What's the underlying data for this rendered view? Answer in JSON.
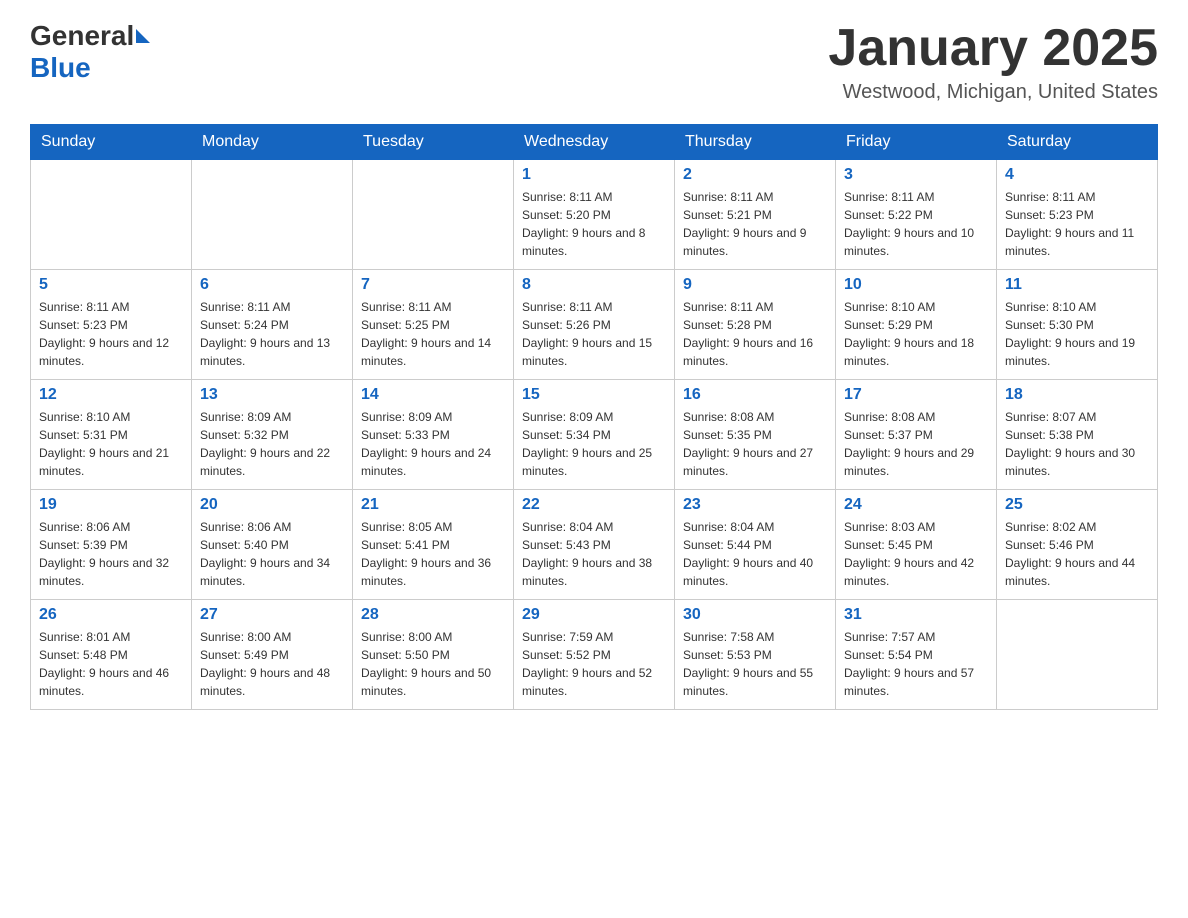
{
  "header": {
    "logo": {
      "general": "General",
      "blue": "Blue"
    },
    "title": "January 2025",
    "location": "Westwood, Michigan, United States"
  },
  "weekdays": [
    "Sunday",
    "Monday",
    "Tuesday",
    "Wednesday",
    "Thursday",
    "Friday",
    "Saturday"
  ],
  "weeks": [
    [
      {
        "day": "",
        "sunrise": "",
        "sunset": "",
        "daylight": ""
      },
      {
        "day": "",
        "sunrise": "",
        "sunset": "",
        "daylight": ""
      },
      {
        "day": "",
        "sunrise": "",
        "sunset": "",
        "daylight": ""
      },
      {
        "day": "1",
        "sunrise": "Sunrise: 8:11 AM",
        "sunset": "Sunset: 5:20 PM",
        "daylight": "Daylight: 9 hours and 8 minutes."
      },
      {
        "day": "2",
        "sunrise": "Sunrise: 8:11 AM",
        "sunset": "Sunset: 5:21 PM",
        "daylight": "Daylight: 9 hours and 9 minutes."
      },
      {
        "day": "3",
        "sunrise": "Sunrise: 8:11 AM",
        "sunset": "Sunset: 5:22 PM",
        "daylight": "Daylight: 9 hours and 10 minutes."
      },
      {
        "day": "4",
        "sunrise": "Sunrise: 8:11 AM",
        "sunset": "Sunset: 5:23 PM",
        "daylight": "Daylight: 9 hours and 11 minutes."
      }
    ],
    [
      {
        "day": "5",
        "sunrise": "Sunrise: 8:11 AM",
        "sunset": "Sunset: 5:23 PM",
        "daylight": "Daylight: 9 hours and 12 minutes."
      },
      {
        "day": "6",
        "sunrise": "Sunrise: 8:11 AM",
        "sunset": "Sunset: 5:24 PM",
        "daylight": "Daylight: 9 hours and 13 minutes."
      },
      {
        "day": "7",
        "sunrise": "Sunrise: 8:11 AM",
        "sunset": "Sunset: 5:25 PM",
        "daylight": "Daylight: 9 hours and 14 minutes."
      },
      {
        "day": "8",
        "sunrise": "Sunrise: 8:11 AM",
        "sunset": "Sunset: 5:26 PM",
        "daylight": "Daylight: 9 hours and 15 minutes."
      },
      {
        "day": "9",
        "sunrise": "Sunrise: 8:11 AM",
        "sunset": "Sunset: 5:28 PM",
        "daylight": "Daylight: 9 hours and 16 minutes."
      },
      {
        "day": "10",
        "sunrise": "Sunrise: 8:10 AM",
        "sunset": "Sunset: 5:29 PM",
        "daylight": "Daylight: 9 hours and 18 minutes."
      },
      {
        "day": "11",
        "sunrise": "Sunrise: 8:10 AM",
        "sunset": "Sunset: 5:30 PM",
        "daylight": "Daylight: 9 hours and 19 minutes."
      }
    ],
    [
      {
        "day": "12",
        "sunrise": "Sunrise: 8:10 AM",
        "sunset": "Sunset: 5:31 PM",
        "daylight": "Daylight: 9 hours and 21 minutes."
      },
      {
        "day": "13",
        "sunrise": "Sunrise: 8:09 AM",
        "sunset": "Sunset: 5:32 PM",
        "daylight": "Daylight: 9 hours and 22 minutes."
      },
      {
        "day": "14",
        "sunrise": "Sunrise: 8:09 AM",
        "sunset": "Sunset: 5:33 PM",
        "daylight": "Daylight: 9 hours and 24 minutes."
      },
      {
        "day": "15",
        "sunrise": "Sunrise: 8:09 AM",
        "sunset": "Sunset: 5:34 PM",
        "daylight": "Daylight: 9 hours and 25 minutes."
      },
      {
        "day": "16",
        "sunrise": "Sunrise: 8:08 AM",
        "sunset": "Sunset: 5:35 PM",
        "daylight": "Daylight: 9 hours and 27 minutes."
      },
      {
        "day": "17",
        "sunrise": "Sunrise: 8:08 AM",
        "sunset": "Sunset: 5:37 PM",
        "daylight": "Daylight: 9 hours and 29 minutes."
      },
      {
        "day": "18",
        "sunrise": "Sunrise: 8:07 AM",
        "sunset": "Sunset: 5:38 PM",
        "daylight": "Daylight: 9 hours and 30 minutes."
      }
    ],
    [
      {
        "day": "19",
        "sunrise": "Sunrise: 8:06 AM",
        "sunset": "Sunset: 5:39 PM",
        "daylight": "Daylight: 9 hours and 32 minutes."
      },
      {
        "day": "20",
        "sunrise": "Sunrise: 8:06 AM",
        "sunset": "Sunset: 5:40 PM",
        "daylight": "Daylight: 9 hours and 34 minutes."
      },
      {
        "day": "21",
        "sunrise": "Sunrise: 8:05 AM",
        "sunset": "Sunset: 5:41 PM",
        "daylight": "Daylight: 9 hours and 36 minutes."
      },
      {
        "day": "22",
        "sunrise": "Sunrise: 8:04 AM",
        "sunset": "Sunset: 5:43 PM",
        "daylight": "Daylight: 9 hours and 38 minutes."
      },
      {
        "day": "23",
        "sunrise": "Sunrise: 8:04 AM",
        "sunset": "Sunset: 5:44 PM",
        "daylight": "Daylight: 9 hours and 40 minutes."
      },
      {
        "day": "24",
        "sunrise": "Sunrise: 8:03 AM",
        "sunset": "Sunset: 5:45 PM",
        "daylight": "Daylight: 9 hours and 42 minutes."
      },
      {
        "day": "25",
        "sunrise": "Sunrise: 8:02 AM",
        "sunset": "Sunset: 5:46 PM",
        "daylight": "Daylight: 9 hours and 44 minutes."
      }
    ],
    [
      {
        "day": "26",
        "sunrise": "Sunrise: 8:01 AM",
        "sunset": "Sunset: 5:48 PM",
        "daylight": "Daylight: 9 hours and 46 minutes."
      },
      {
        "day": "27",
        "sunrise": "Sunrise: 8:00 AM",
        "sunset": "Sunset: 5:49 PM",
        "daylight": "Daylight: 9 hours and 48 minutes."
      },
      {
        "day": "28",
        "sunrise": "Sunrise: 8:00 AM",
        "sunset": "Sunset: 5:50 PM",
        "daylight": "Daylight: 9 hours and 50 minutes."
      },
      {
        "day": "29",
        "sunrise": "Sunrise: 7:59 AM",
        "sunset": "Sunset: 5:52 PM",
        "daylight": "Daylight: 9 hours and 52 minutes."
      },
      {
        "day": "30",
        "sunrise": "Sunrise: 7:58 AM",
        "sunset": "Sunset: 5:53 PM",
        "daylight": "Daylight: 9 hours and 55 minutes."
      },
      {
        "day": "31",
        "sunrise": "Sunrise: 7:57 AM",
        "sunset": "Sunset: 5:54 PM",
        "daylight": "Daylight: 9 hours and 57 minutes."
      },
      {
        "day": "",
        "sunrise": "",
        "sunset": "",
        "daylight": ""
      }
    ]
  ]
}
